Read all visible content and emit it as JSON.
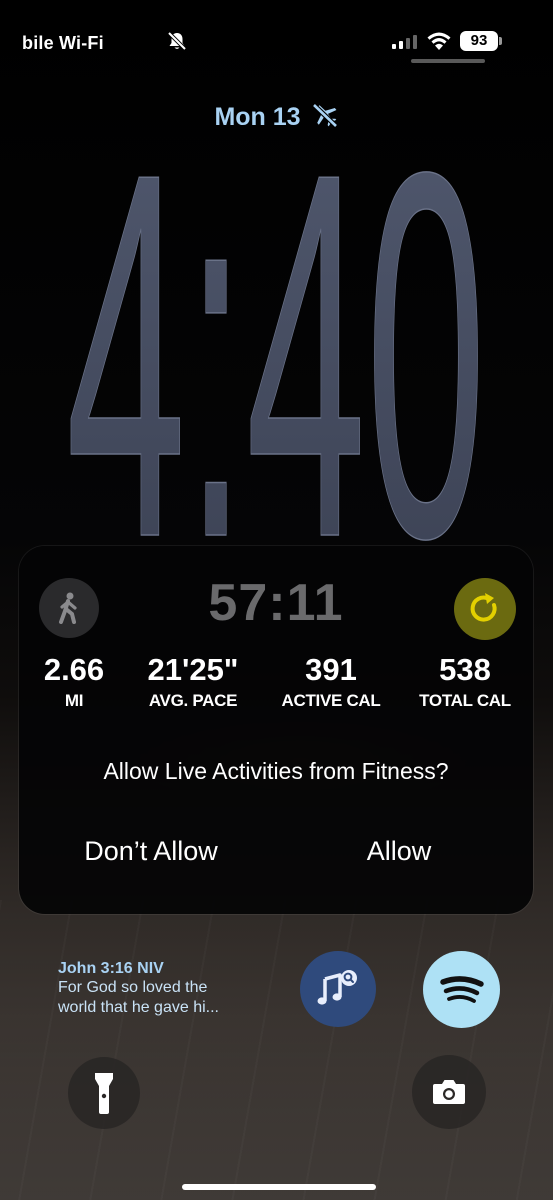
{
  "status_bar": {
    "carrier": "bile Wi-Fi",
    "battery": "93"
  },
  "lock_screen": {
    "date": "Mon 13",
    "time": "4:40"
  },
  "live_activity": {
    "timer": "57:11",
    "stats": [
      {
        "value": "2.66",
        "label": "MI"
      },
      {
        "value": "21'25\"",
        "label": "AVG. PACE"
      },
      {
        "value": "391",
        "label": "ACTIVE CAL"
      },
      {
        "value": "538",
        "label": "TOTAL CAL"
      }
    ],
    "prompt": "Allow Live Activities from Fitness?",
    "deny_label": "Don’t Allow",
    "allow_label": "Allow"
  },
  "verse_widget": {
    "reference": "John 3:16 NIV",
    "line1": "For God so loved the",
    "line2": "world that he gave hi..."
  },
  "colors": {
    "date_accent": "#a9d2f3",
    "clock": "#434a5e",
    "refresh": "#e3d000",
    "music_widget": "#2f4a7c",
    "spotify_widget": "#aee1f5"
  }
}
